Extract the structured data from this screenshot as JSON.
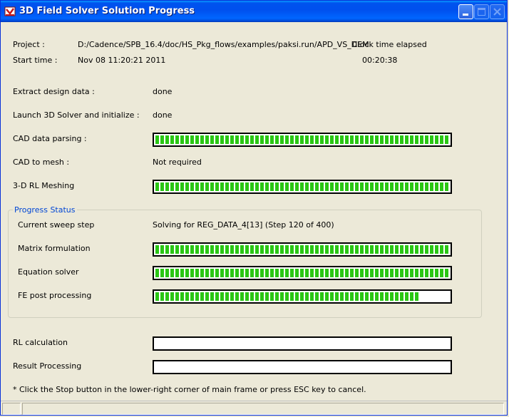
{
  "window": {
    "title": "3D Field Solver Solution Progress"
  },
  "project": {
    "label": "Project :",
    "value": "D:/Cadence/SPB_16.4/doc/HS_Pkg_flows/examples/paksi.run/APD_VS_DEM",
    "clock_label": "Clock time elapsed"
  },
  "start": {
    "label": "Start time :",
    "value": "Nov 08 11:20:21 2011",
    "elapsed": "00:20:38"
  },
  "steps": {
    "extract": {
      "label": "Extract design data :",
      "value": "done"
    },
    "launch": {
      "label": "Launch 3D Solver and initialize :",
      "value": "done"
    },
    "cad_parse": {
      "label": "CAD data parsing :",
      "progress": 1.0
    },
    "cad_mesh": {
      "label": "CAD to mesh :",
      "value": "Not required"
    },
    "rl_mesh": {
      "label": "3-D RL Meshing",
      "progress": 1.0
    }
  },
  "progress_status": {
    "title": "Progress Status",
    "sweep": {
      "label": "Current sweep step",
      "value": "Solving for REG_DATA_4[13] (Step 120 of 400)"
    },
    "matrix": {
      "label": "Matrix formulation",
      "progress": 1.0
    },
    "equation": {
      "label": "Equation solver",
      "progress": 1.0
    },
    "fe_post": {
      "label": "FE post processing",
      "progress": 0.9
    }
  },
  "rl_calc": {
    "label": "RL calculation",
    "progress": 0.0
  },
  "result": {
    "label": "Result Processing",
    "progress": 0.0
  },
  "note": "* Click the Stop button in the lower-right corner of main frame or press ESC key to cancel.",
  "colors": {
    "bar_fill": "#2ac614",
    "title_bar": "#0053ee",
    "group_title": "#0046d5"
  }
}
